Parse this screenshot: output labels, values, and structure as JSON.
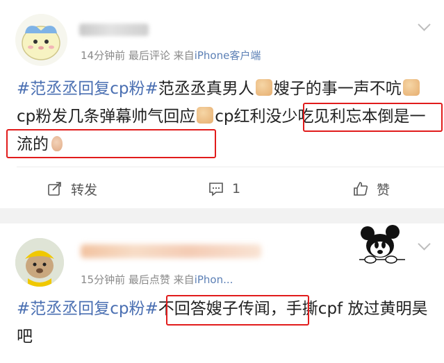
{
  "posts": [
    {
      "avatar": "cartoon-cat-avatar",
      "time": "14分钟前",
      "source_prefix": "最后评论",
      "from_label": "来自",
      "device": "iPhone客户端",
      "text": {
        "tag": "#范丞丞回复cp粉#",
        "part1": "范丞丞真男人",
        "part2": "嫂子的事一声不吭",
        "part3": "cp粉发几条弹幕帅气回应",
        "part4": "cp红利没少吃见利忘本倒是一流的"
      },
      "actions": {
        "repost_label": "转发",
        "comment_count": "1",
        "like_label": "赞"
      }
    },
    {
      "avatar": "dog-in-costume-avatar",
      "time": "15分钟前",
      "source_prefix": "最后点赞",
      "from_label": "来自",
      "device": "iPhon...",
      "text": {
        "tag": "#范丞丞回复cp粉#",
        "part1": "不回答嫂子传闻，",
        "part2": "手撕cpf 放过黄明昊吧"
      }
    }
  ],
  "colors": {
    "topic_link": "#4a6fb2",
    "highlight_box": "#e11b1b",
    "meta_text": "#8a8a8a"
  }
}
